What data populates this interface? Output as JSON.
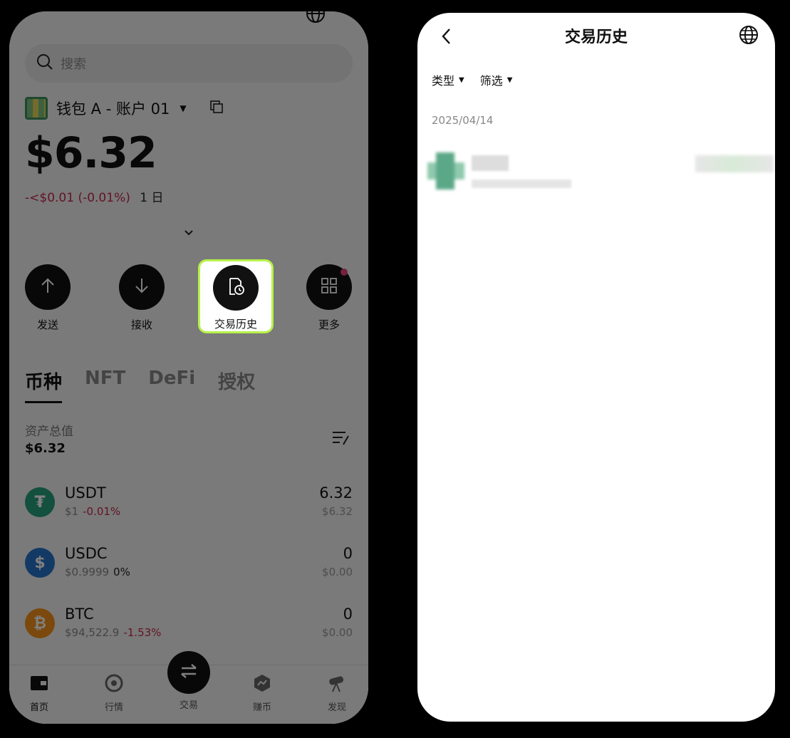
{
  "wallet_home": {
    "search_placeholder": "搜索",
    "account_name": "钱包 A - 账户 01",
    "balance": "$6.32",
    "change_text": "-<$0.01 (-0.01%)",
    "change_period": "1 日",
    "actions": [
      {
        "label": "发送",
        "icon": "arrow-up-icon"
      },
      {
        "label": "接收",
        "icon": "arrow-down-icon"
      },
      {
        "label": "交易历史",
        "icon": "history-icon"
      },
      {
        "label": "更多",
        "icon": "grid-icon"
      }
    ],
    "asset_tabs": [
      "币种",
      "NFT",
      "DeFi",
      "授权"
    ],
    "active_tab": "币种",
    "total_label": "资产总值",
    "total_value": "$6.32",
    "tokens": [
      {
        "symbol": "USDT",
        "price": "$1",
        "change": "-0.01%",
        "amount": "6.32",
        "value": "$6.32",
        "color": "#26a17b"
      },
      {
        "symbol": "USDC",
        "price": "$0.9999",
        "change": "0%",
        "amount": "0",
        "value": "$0.00",
        "color": "#2775ca"
      },
      {
        "symbol": "BTC",
        "price": "$94,522.9",
        "change": "-1.53%",
        "amount": "0",
        "value": "$0.00",
        "color": "#f7931a"
      }
    ],
    "bottom_nav": [
      {
        "label": "首页",
        "icon": "wallet-icon"
      },
      {
        "label": "行情",
        "icon": "market-icon"
      },
      {
        "label": "交易",
        "icon": "swap-icon"
      },
      {
        "label": "赚币",
        "icon": "earn-icon"
      },
      {
        "label": "发现",
        "icon": "discover-icon"
      }
    ],
    "highlight_color": "#b7f249"
  },
  "tx_history": {
    "title": "交易历史",
    "filters": [
      "类型",
      "筛选"
    ],
    "date_header": "2025/04/14"
  }
}
